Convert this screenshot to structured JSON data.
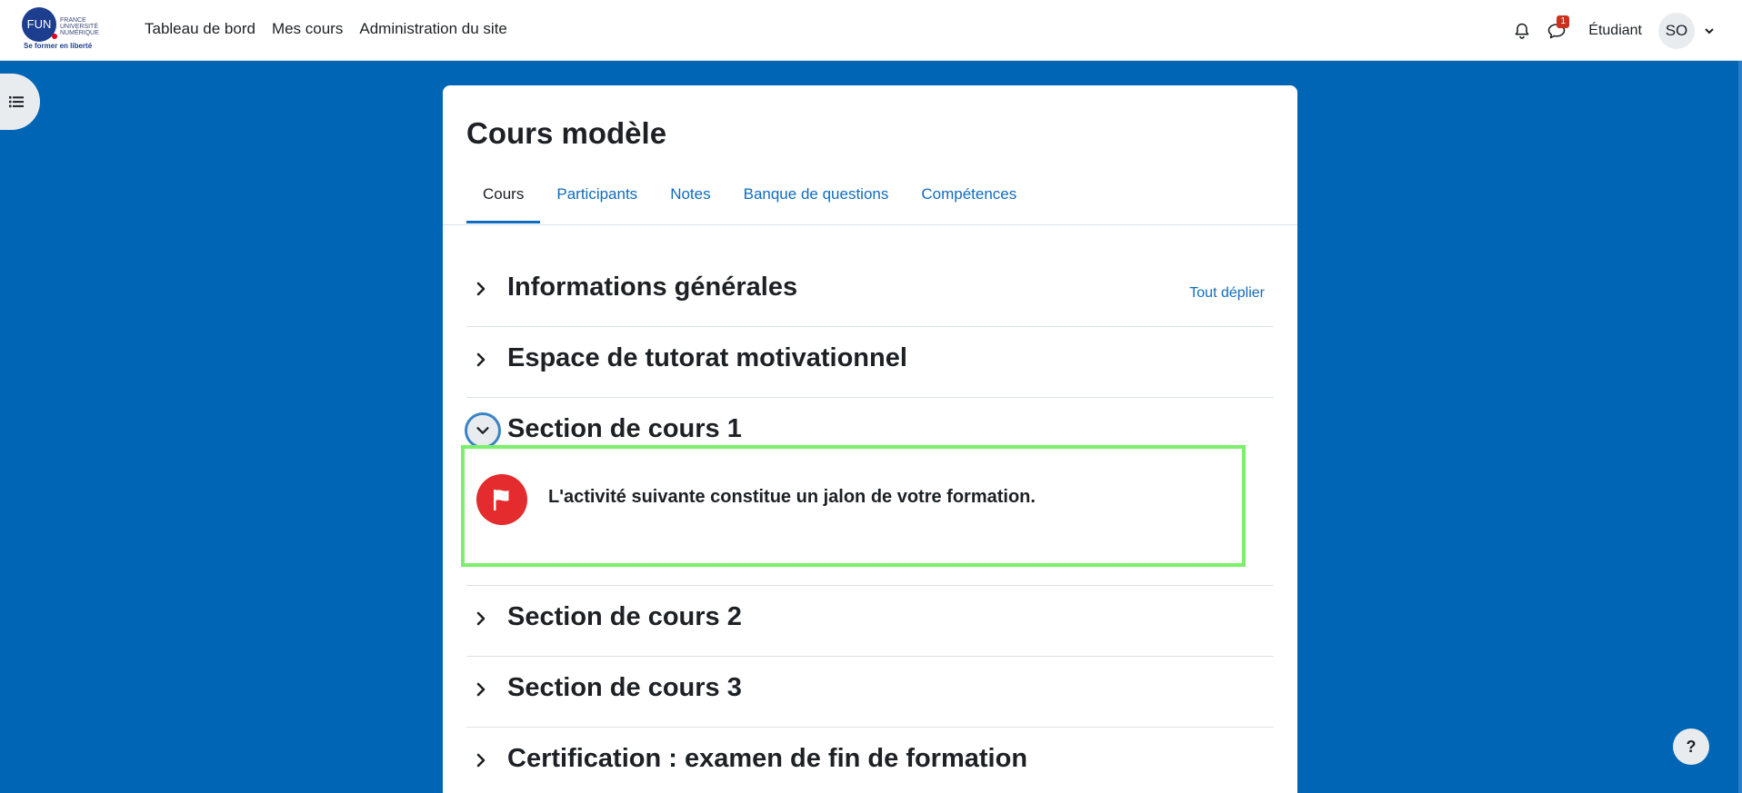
{
  "navbar": {
    "logo": {
      "abbrev": "FUN",
      "line1": "FRANCE",
      "line2": "UNIVERSITÉ",
      "line3": "NUMÉRIQUE",
      "tagline": "Se former en liberté"
    },
    "links": [
      "Tableau de bord",
      "Mes cours",
      "Administration du site"
    ],
    "notifications_icon": "bell-icon",
    "messages_icon": "chat-icon",
    "messages_badge": "1",
    "role": "Étudiant",
    "avatar_initials": "SO"
  },
  "course": {
    "title": "Cours modèle",
    "tabs": [
      "Cours",
      "Participants",
      "Notes",
      "Banque de questions",
      "Compétences"
    ],
    "active_tab": "Cours",
    "expand_all": "Tout déplier",
    "sections": [
      {
        "title": "Informations générales",
        "expanded": false
      },
      {
        "title": "Espace de tutorat motivationnel",
        "expanded": false
      },
      {
        "title": "Section de cours 1",
        "expanded": true
      },
      {
        "title": "Section de cours 2",
        "expanded": false
      },
      {
        "title": "Section de cours 3",
        "expanded": false
      },
      {
        "title": "Certification : examen de fin de formation",
        "expanded": false
      }
    ],
    "milestone_text": "L'activité suivante constitue un jalon de votre formation."
  },
  "help_button": "?",
  "colors": {
    "background": "#0065b5",
    "link": "#0f6cbf",
    "highlight": "#7cef6b",
    "flag": "#e42b2d",
    "badge": "#ca3120"
  }
}
